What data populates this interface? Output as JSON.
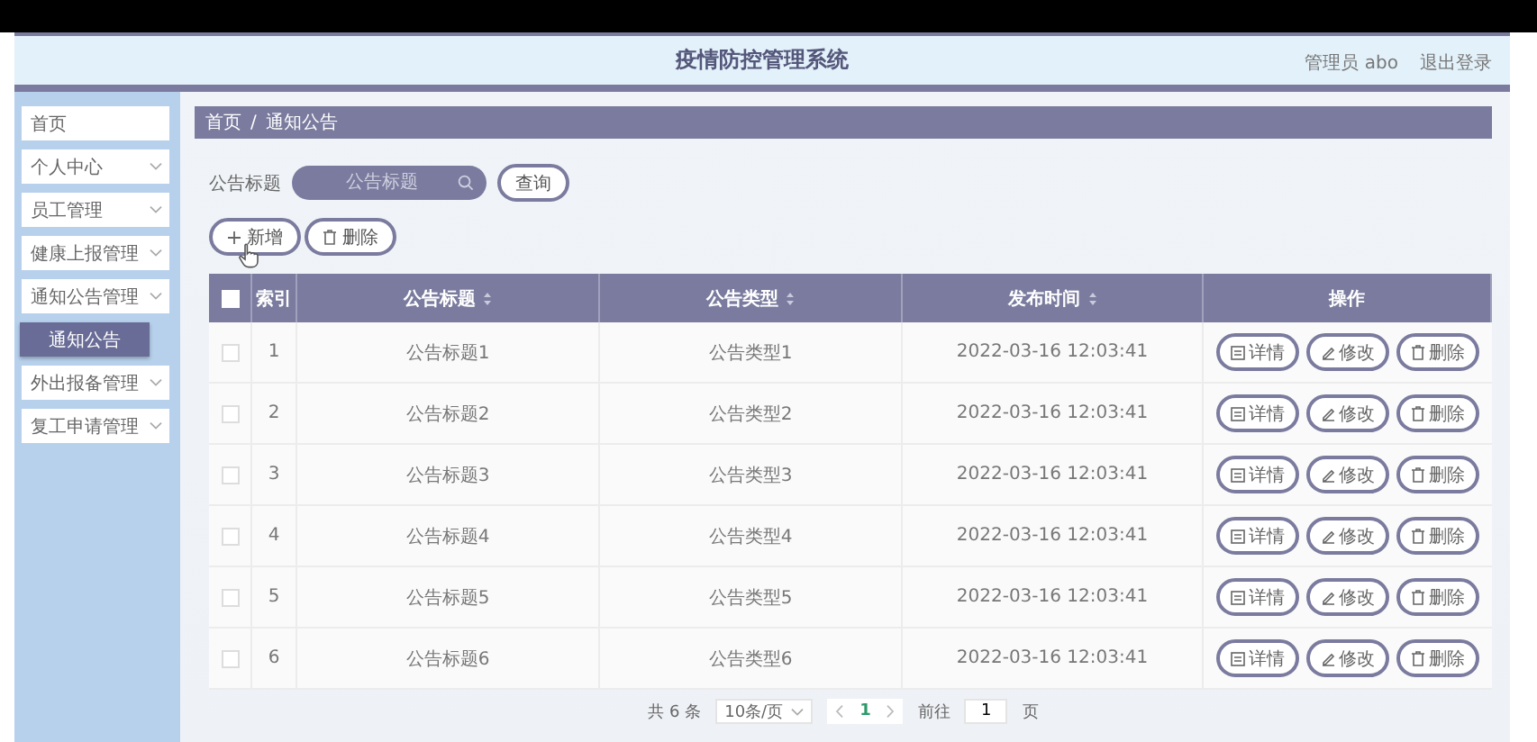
{
  "header": {
    "title": "疫情防控管理系统",
    "user": "管理员 abo",
    "logout": "退出登录"
  },
  "sidebar": {
    "items": [
      {
        "label": "首页",
        "kind": "link"
      },
      {
        "label": "个人中心",
        "kind": "submenu"
      },
      {
        "label": "员工管理",
        "kind": "submenu"
      },
      {
        "label": "健康上报管理",
        "kind": "submenu"
      },
      {
        "label": "通知公告管理",
        "kind": "submenu",
        "children": [
          {
            "label": "通知公告",
            "selected": true
          }
        ]
      },
      {
        "label": "外出报备管理",
        "kind": "submenu"
      },
      {
        "label": "复工申请管理",
        "kind": "submenu"
      }
    ]
  },
  "breadcrumb": [
    "首页",
    "/",
    "通知公告"
  ],
  "search": {
    "label": "公告标题",
    "placeholder": "公告标题",
    "button": "查询"
  },
  "actions": [
    {
      "label": "新增",
      "kind": "add"
    },
    {
      "label": "删除",
      "kind": "delete"
    }
  ],
  "table": {
    "select_all_checked": false,
    "columns": [
      {
        "label": "索引",
        "sortable": false
      },
      {
        "label": "公告标题",
        "sortable": true
      },
      {
        "label": "公告类型",
        "sortable": true
      },
      {
        "label": "发布时间",
        "sortable": true
      },
      {
        "label": "操作",
        "sortable": false
      }
    ],
    "rows": [
      {
        "checked": false,
        "cells": [
          "1",
          "公告标题1",
          "公告类型1",
          "2022-03-16 12:03:41"
        ],
        "buttons": [
          {
            "label": "详情",
            "kind": "detail"
          },
          {
            "label": "修改",
            "kind": "edit"
          },
          {
            "label": "删除",
            "kind": "delete"
          }
        ]
      },
      {
        "checked": false,
        "cells": [
          "2",
          "公告标题2",
          "公告类型2",
          "2022-03-16 12:03:41"
        ],
        "buttons": [
          {
            "label": "详情",
            "kind": "detail"
          },
          {
            "label": "修改",
            "kind": "edit"
          },
          {
            "label": "删除",
            "kind": "delete"
          }
        ]
      },
      {
        "checked": false,
        "cells": [
          "3",
          "公告标题3",
          "公告类型3",
          "2022-03-16 12:03:41"
        ],
        "buttons": [
          {
            "label": "详情",
            "kind": "detail"
          },
          {
            "label": "修改",
            "kind": "edit"
          },
          {
            "label": "删除",
            "kind": "delete"
          }
        ]
      },
      {
        "checked": false,
        "cells": [
          "4",
          "公告标题4",
          "公告类型4",
          "2022-03-16 12:03:41"
        ],
        "buttons": [
          {
            "label": "详情",
            "kind": "detail"
          },
          {
            "label": "修改",
            "kind": "edit"
          },
          {
            "label": "删除",
            "kind": "delete"
          }
        ]
      },
      {
        "checked": false,
        "cells": [
          "5",
          "公告标题5",
          "公告类型5",
          "2022-03-16 12:03:41"
        ],
        "buttons": [
          {
            "label": "详情",
            "kind": "detail"
          },
          {
            "label": "修改",
            "kind": "edit"
          },
          {
            "label": "删除",
            "kind": "delete"
          }
        ]
      },
      {
        "checked": false,
        "cells": [
          "6",
          "公告标题6",
          "公告类型6",
          "2022-03-16 12:03:41"
        ],
        "buttons": [
          {
            "label": "详情",
            "kind": "detail"
          },
          {
            "label": "修改",
            "kind": "edit"
          },
          {
            "label": "删除",
            "kind": "delete"
          }
        ]
      }
    ]
  },
  "pagination": {
    "total": "共 6 条",
    "page_size": "10条/页",
    "pages": [
      {
        "label": "1",
        "selected": true
      }
    ],
    "goto_label": "前往",
    "goto_value": "1",
    "goto_suffix": "页"
  }
}
